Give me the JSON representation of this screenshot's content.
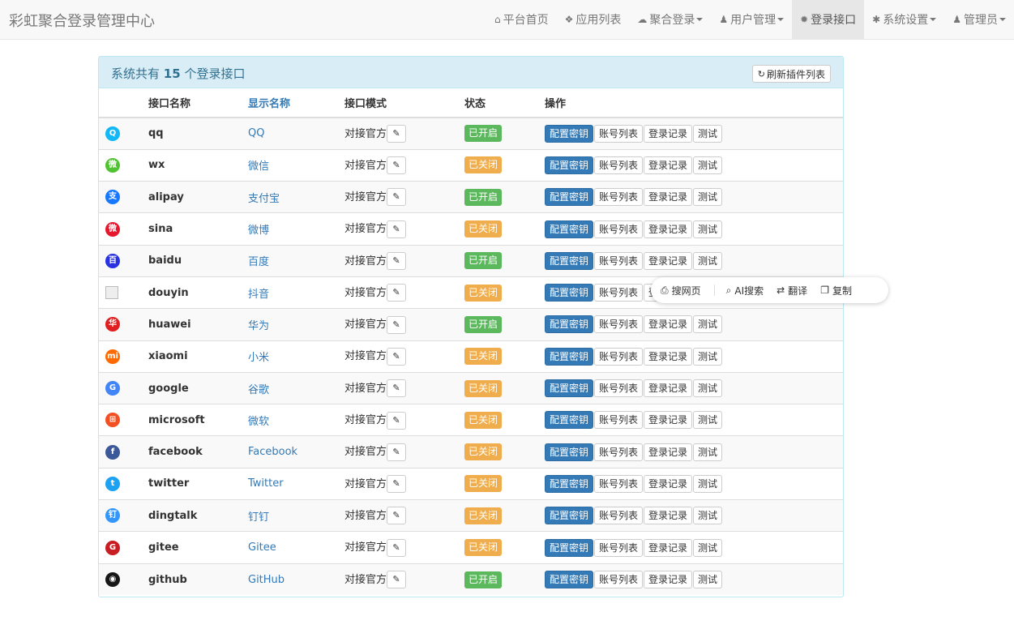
{
  "brand": "彩虹聚合登录管理中心",
  "nav": [
    {
      "label": "平台首页",
      "icon": "home-icon",
      "glyph": "⌂",
      "caret": false,
      "active": false
    },
    {
      "label": "应用列表",
      "icon": "cubes-icon",
      "glyph": "❖",
      "caret": false,
      "active": false
    },
    {
      "label": "聚合登录",
      "icon": "cloud-icon",
      "glyph": "☁",
      "caret": true,
      "active": false
    },
    {
      "label": "用户管理",
      "icon": "user-icon",
      "glyph": "♟",
      "caret": true,
      "active": false
    },
    {
      "label": "登录接口",
      "icon": "cog-icon",
      "glyph": "✹",
      "caret": false,
      "active": true
    },
    {
      "label": "系统设置",
      "icon": "gear-icon",
      "glyph": "✱",
      "caret": true,
      "active": false
    },
    {
      "label": "管理员",
      "icon": "user-icon",
      "glyph": "♟",
      "caret": true,
      "active": false
    }
  ],
  "panel": {
    "title_prefix": "系统共有",
    "count": "15",
    "title_suffix": "个登录接口",
    "refresh_label": "刷新插件列表"
  },
  "table": {
    "headers": [
      "接口名称",
      "显示名称",
      "接口模式",
      "状态",
      "操作"
    ],
    "rows": [
      {
        "name": "qq",
        "display": "QQ",
        "logo_color": "#12b7f5",
        "logo_text": "Q",
        "status": "on"
      },
      {
        "name": "wx",
        "display": "微信",
        "logo_color": "#51c332",
        "logo_text": "微",
        "status": "off"
      },
      {
        "name": "alipay",
        "display": "支付宝",
        "logo_color": "#1677ff",
        "logo_text": "支",
        "status": "on"
      },
      {
        "name": "sina",
        "display": "微博",
        "logo_color": "#e6162d",
        "logo_text": "微",
        "status": "off"
      },
      {
        "name": "baidu",
        "display": "百度",
        "logo_color": "#2932e1",
        "logo_text": "百",
        "status": "on"
      },
      {
        "name": "douyin",
        "display": "抖音",
        "logo_color": "",
        "logo_text": "",
        "status": "off",
        "broken": true
      },
      {
        "name": "huawei",
        "display": "华为",
        "logo_color": "#e02020",
        "logo_text": "华",
        "status": "on"
      },
      {
        "name": "xiaomi",
        "display": "小米",
        "logo_color": "#ff6900",
        "logo_text": "mi",
        "status": "off"
      },
      {
        "name": "google",
        "display": "谷歌",
        "logo_color": "#4285f4",
        "logo_text": "G",
        "status": "off"
      },
      {
        "name": "microsoft",
        "display": "微软",
        "logo_color": "#f25022",
        "logo_text": "⊞",
        "status": "off"
      },
      {
        "name": "facebook",
        "display": "Facebook",
        "logo_color": "#3b5998",
        "logo_text": "f",
        "status": "off"
      },
      {
        "name": "twitter",
        "display": "Twitter",
        "logo_color": "#1da1f2",
        "logo_text": "t",
        "status": "off"
      },
      {
        "name": "dingtalk",
        "display": "钉钉",
        "logo_color": "#3296fa",
        "logo_text": "钉",
        "status": "off"
      },
      {
        "name": "gitee",
        "display": "Gitee",
        "logo_color": "#c71d23",
        "logo_text": "G",
        "status": "off"
      },
      {
        "name": "github",
        "display": "GitHub",
        "logo_color": "#181717",
        "logo_text": "◉",
        "status": "on"
      }
    ],
    "mode_label": "对接官方",
    "status_on": "已开启",
    "status_off": "已关闭",
    "ops": {
      "config": "配置密钥",
      "accounts": "账号列表",
      "logs": "登录记录",
      "test": "测试"
    }
  },
  "float_toolbar": {
    "items": [
      {
        "label": "搜网页",
        "icon": "search-web-icon",
        "glyph": "⎙"
      },
      {
        "label": "AI搜索",
        "icon": "search-icon",
        "glyph": "⌕"
      },
      {
        "label": "翻译",
        "icon": "translate-icon",
        "glyph": "⇄"
      },
      {
        "label": "复制",
        "icon": "copy-icon",
        "glyph": "❐"
      }
    ]
  }
}
